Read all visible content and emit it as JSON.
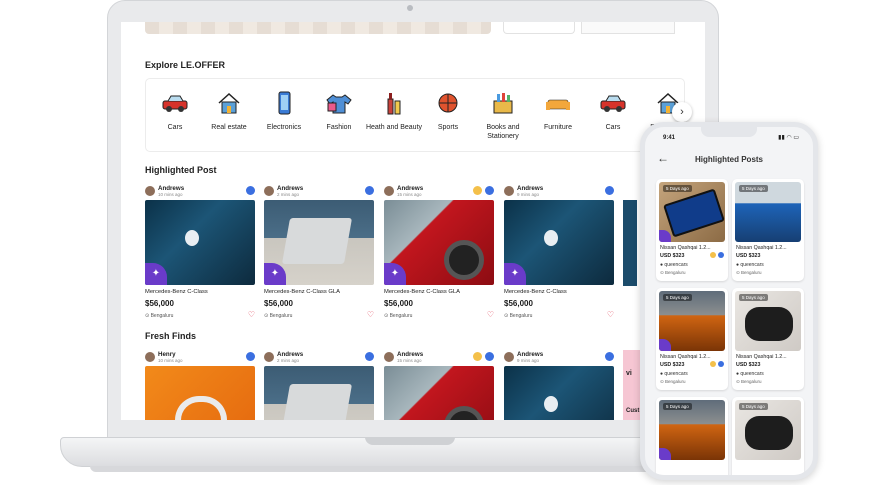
{
  "explore": {
    "title": "Explore LE.OFFER",
    "categories": [
      {
        "label": "Cars",
        "icon": "car-icon"
      },
      {
        "label": "Real estate",
        "icon": "house-icon"
      },
      {
        "label": "Electronics",
        "icon": "phone-icon"
      },
      {
        "label": "Fashion",
        "icon": "tshirt-icon"
      },
      {
        "label": "Heath and Beauty",
        "icon": "cosmetics-icon"
      },
      {
        "label": "Sports",
        "icon": "basketball-icon"
      },
      {
        "label": "Books and Stationery",
        "icon": "stationery-icon"
      },
      {
        "label": "Furniture",
        "icon": "sofa-icon"
      },
      {
        "label": "Cars",
        "icon": "car-icon"
      },
      {
        "label": "Real estate",
        "icon": "house-icon"
      }
    ],
    "next_arrow": "›"
  },
  "highlighted": {
    "title": "Highlighted Post",
    "cards": [
      {
        "user": "Andrews",
        "time": "10 mins ago",
        "title": "Mercedes-Benz C-Class",
        "price": "$56,000",
        "location": "Bengaluru"
      },
      {
        "user": "Andrews",
        "time": "2 mins ago",
        "title": "Mercedes-Benz C-Class GLA",
        "price": "$56,000",
        "location": "Bengaluru"
      },
      {
        "user": "Andrews",
        "time": "15 mins ago",
        "title": "Mercedes-Benz C-Class GLA",
        "price": "$56,000",
        "location": "Bengaluru"
      },
      {
        "user": "Andrews",
        "time": "9 mins ago",
        "title": "Mercedes-Benz C-Class",
        "price": "$56,000",
        "location": "Bengaluru"
      }
    ]
  },
  "fresh": {
    "title": "Fresh Finds",
    "cards": [
      {
        "user": "Henry",
        "time": "10 mins ago"
      },
      {
        "user": "Andrews",
        "time": "2 mins ago"
      },
      {
        "user": "Andrews",
        "time": "15 mins ago"
      },
      {
        "user": "Andrews",
        "time": "9 mins ago"
      }
    ],
    "promo_letter": "vi",
    "promo_text": "Cust"
  },
  "phone": {
    "status_time": "9:41",
    "title": "Highlighted Posts",
    "back": "←",
    "cards": [
      {
        "tag": "5 Days ago",
        "title": "Nissan Qashqai 1.2...",
        "price": "USD $323",
        "user": "queencars",
        "location": "Bengaluru"
      },
      {
        "tag": "5 Days ago",
        "title": "Nissan Qashqai 1.2...",
        "price": "USD $323",
        "user": "queencars",
        "location": "Bengaluru"
      },
      {
        "tag": "5 Days ago",
        "title": "Nissan Qashqai 1.2...",
        "price": "USD $323",
        "user": "queencars",
        "location": "Bengaluru"
      },
      {
        "tag": "5 Days ago",
        "title": "Nissan Qashqai 1.2...",
        "price": "USD $323",
        "user": "queencars",
        "location": "Bengaluru"
      },
      {
        "tag": "5 Days ago"
      },
      {
        "tag": "5 Days ago"
      }
    ]
  },
  "colors": {
    "brand": "#6a3bc9",
    "verified": "#3b6fe0",
    "premium": "#f4c04a",
    "heart": "#e2455b"
  }
}
